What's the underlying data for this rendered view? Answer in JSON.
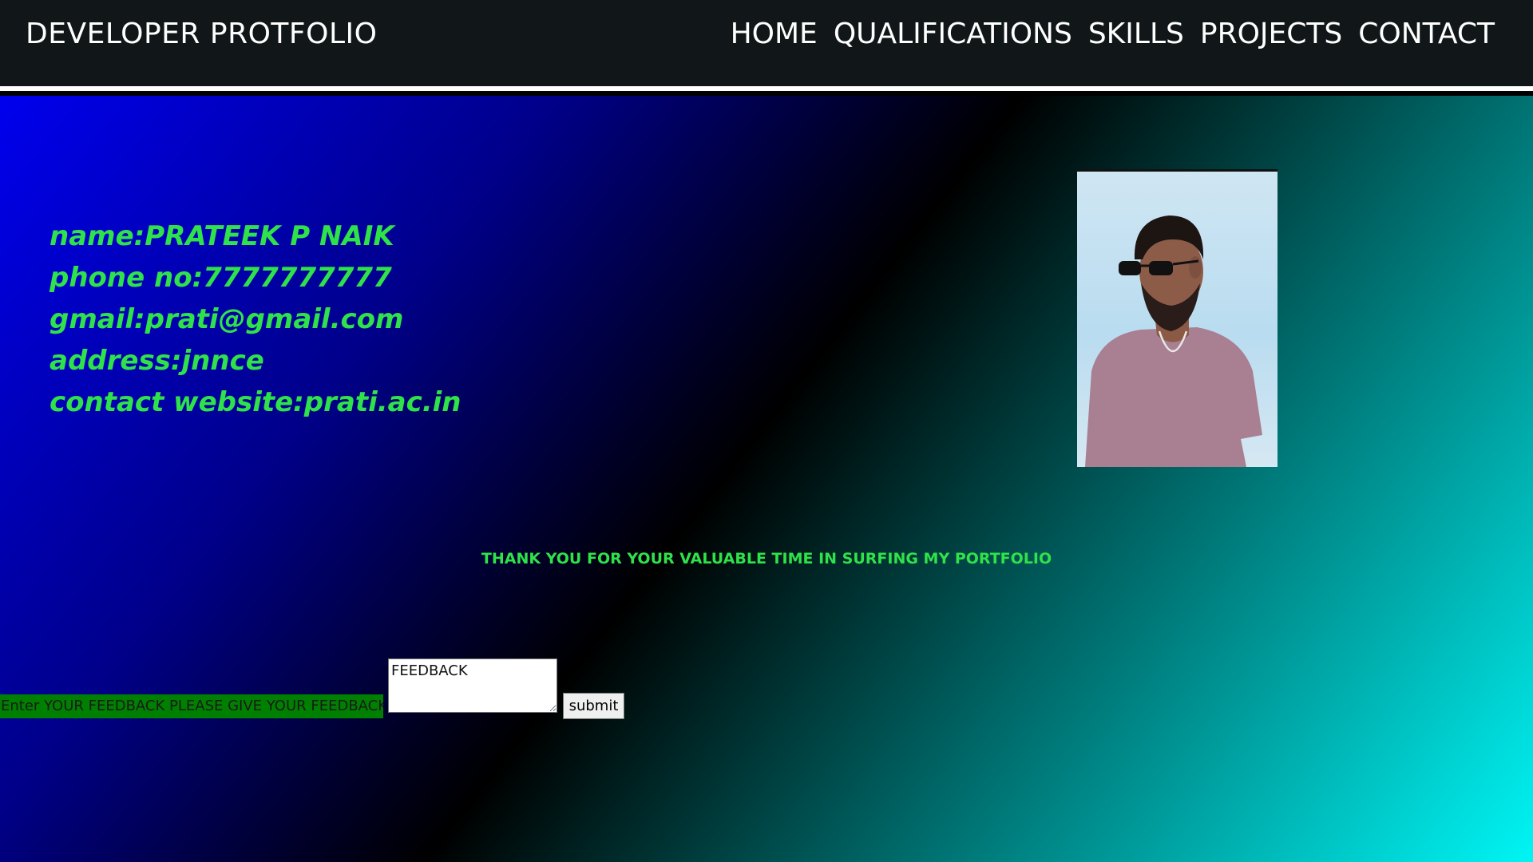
{
  "header": {
    "brand": "DEVELOPER PROTFOLIO",
    "nav": [
      "HOME",
      "QUALIFICATIONS",
      "SKILLS",
      "PROJECTS",
      "CONTACT"
    ]
  },
  "contact": {
    "lines": [
      "name:PRATEEK P NAIK",
      "phone no:7777777777",
      "gmail:prati@gmail.com",
      "address:jnnce",
      "contact website:prati.ac.in"
    ],
    "photo_icon": "profile-photo"
  },
  "thanks_message": "THANK YOU FOR YOUR VALUABLE TIME IN SURFING MY PORTFOLIO",
  "feedback": {
    "label": "Enter YOUR FEEDBACK PLEASE GIVE YOUR FEEDBACK",
    "textarea_value": "FEEDBACK",
    "submit_label": "submit"
  },
  "colors": {
    "accent_text": "#2fe24a",
    "navbar_bg": "#111718",
    "label_bg": "#008000"
  }
}
